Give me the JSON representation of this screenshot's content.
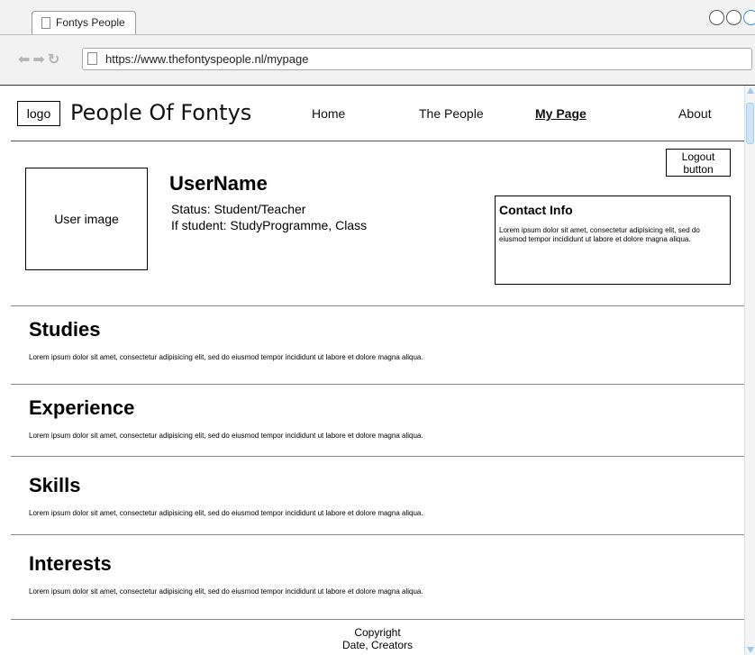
{
  "browser": {
    "tab_title": "Fontys People",
    "url": "https://www.thefontyspeople.nl/mypage"
  },
  "header": {
    "logo": "logo",
    "title": "People Of Fontys",
    "nav": [
      "Home",
      "The People",
      "My Page",
      "About"
    ],
    "active_nav": "My Page"
  },
  "profile": {
    "logout": "Logout button",
    "image_label": "User image",
    "username": "UserName",
    "status": "Status: Student/Teacher",
    "student_info": "If student: StudyProgramme, Class",
    "contact_title": "Contact Info",
    "contact_text": "Lorem ipsum dolor sit amet, consectetur adipisicing elit, sed do eiusmod tempor incididunt ut labore et dolore magna aliqua."
  },
  "sections": [
    {
      "title": "Studies",
      "text": "Lorem ipsum dolor sit amet, consectetur adipisicing elit, sed do eiusmod tempor incididunt ut labore et dolore magna aliqua."
    },
    {
      "title": "Experience",
      "text": "Lorem ipsum dolor sit amet, consectetur adipisicing elit, sed do eiusmod tempor incididunt ut labore et dolore magna aliqua."
    },
    {
      "title": "Skills",
      "text": "Lorem ipsum dolor sit amet, consectetur adipisicing elit, sed do eiusmod tempor incididunt ut labore et dolore magna aliqua."
    },
    {
      "title": "Interests",
      "text": "Lorem ipsum dolor sit amet, consectetur adipisicing elit, sed do eiusmod tempor incididunt ut labore et dolore magna aliqua."
    }
  ],
  "footer": {
    "line1": "Copyright",
    "line2": "Date, Creators"
  }
}
